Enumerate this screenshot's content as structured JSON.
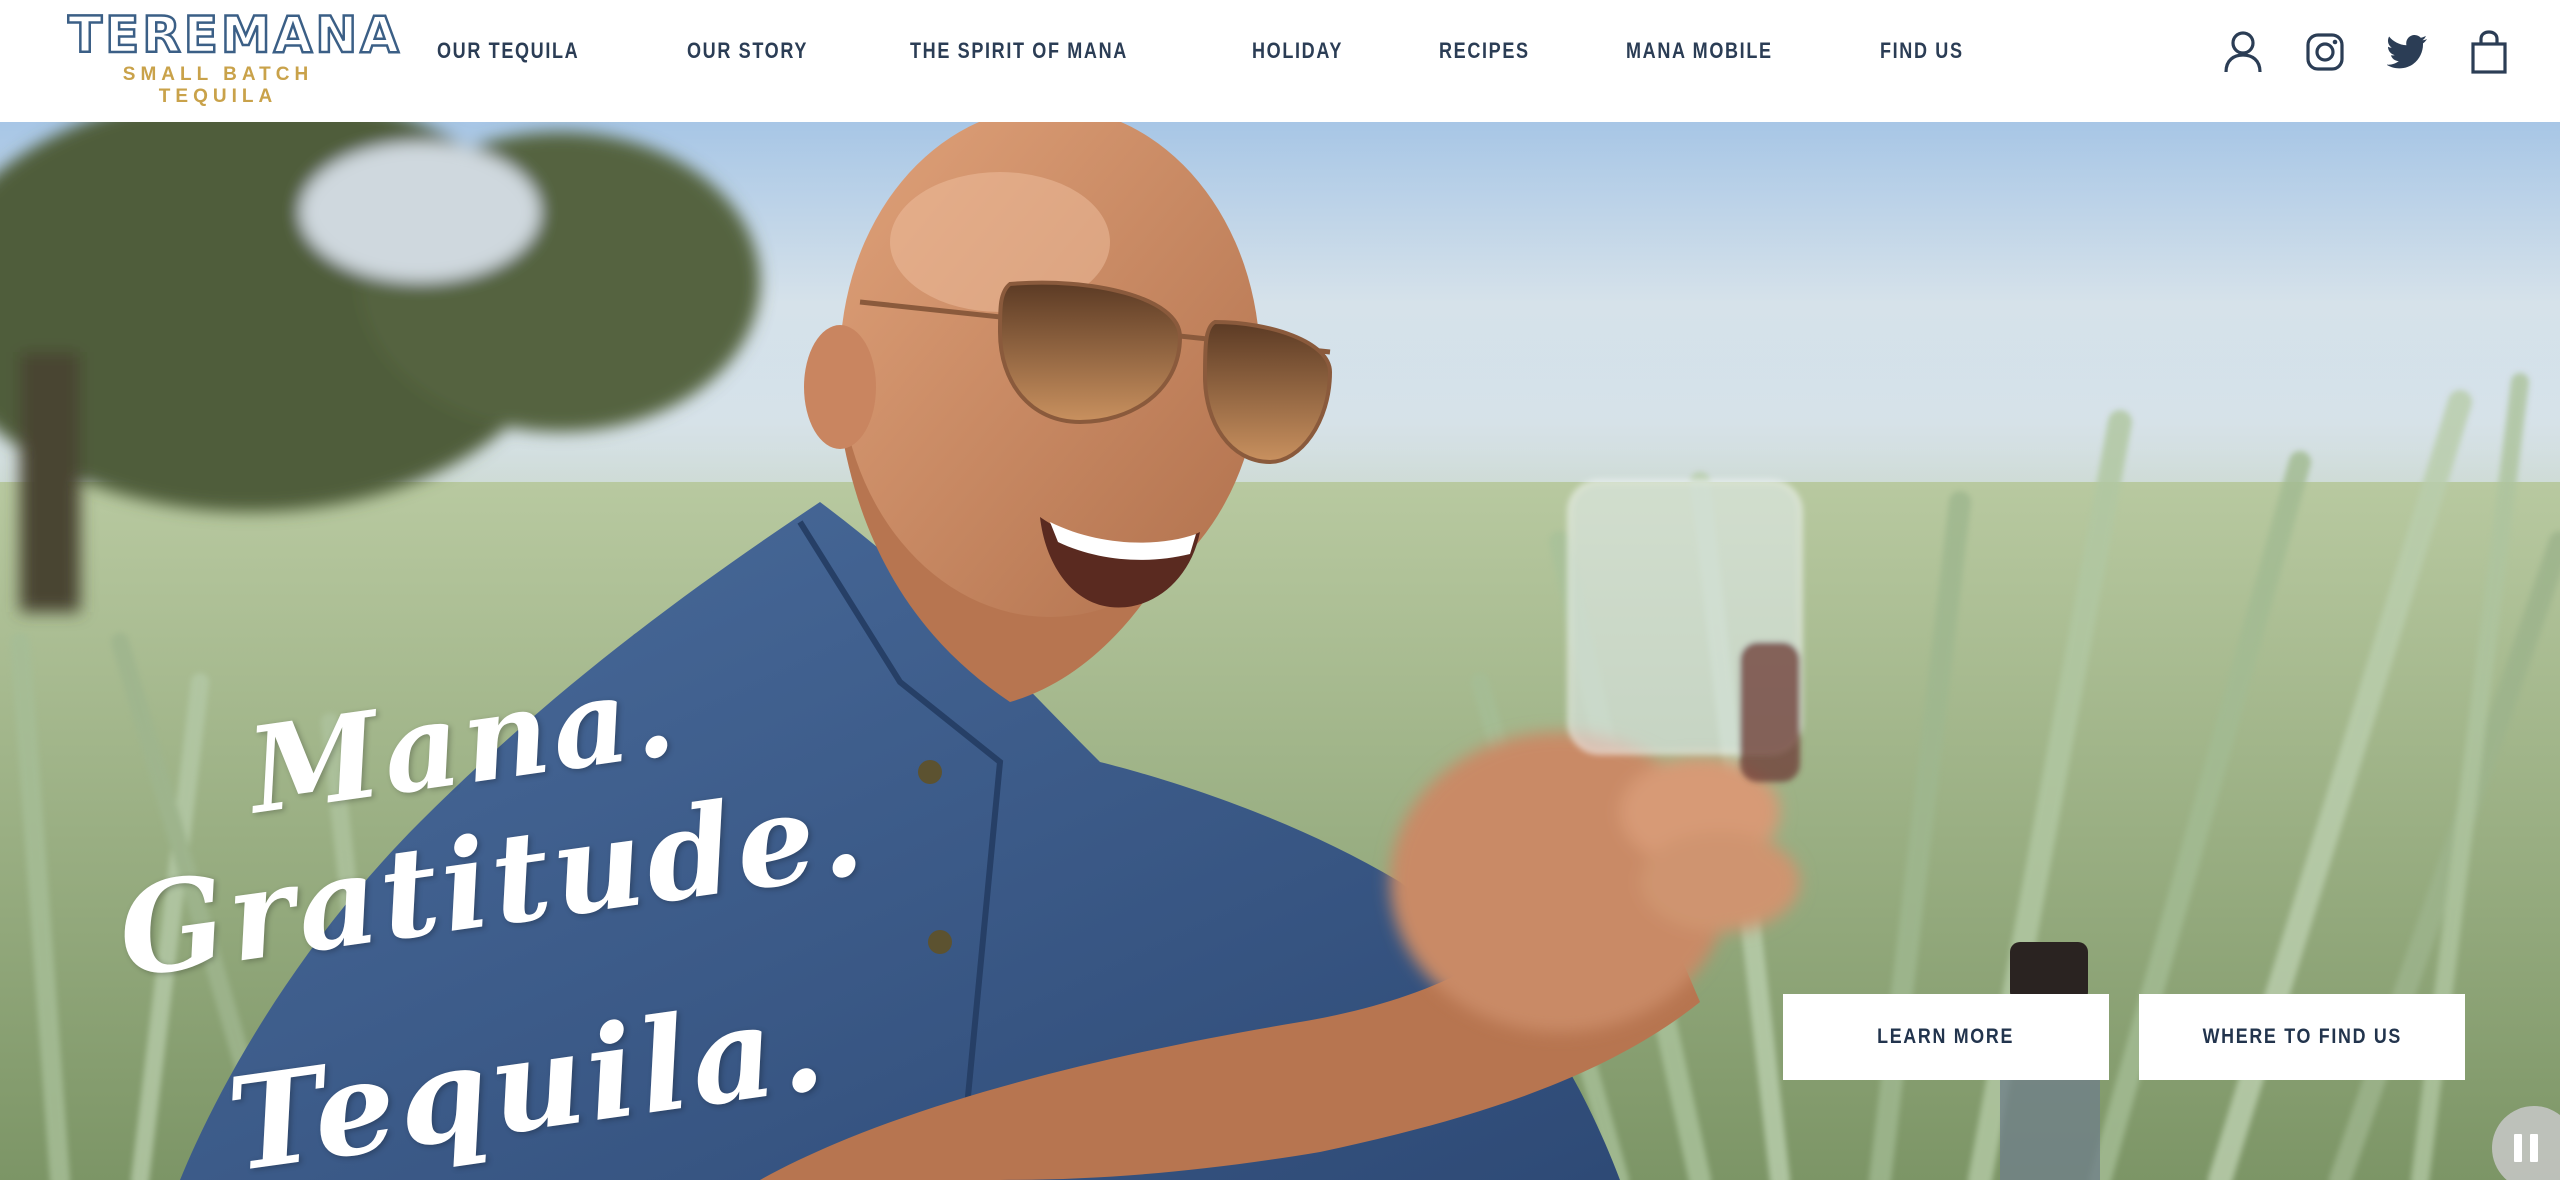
{
  "brand": {
    "name": "TEREMANA",
    "tagline": "SMALL BATCH TEQUILA",
    "color_primary": "#3b5f86",
    "color_gold": "#c9a24a"
  },
  "nav": {
    "items": [
      {
        "label": "OUR TEQUILA"
      },
      {
        "label": "OUR STORY"
      },
      {
        "label": "THE SPIRIT OF MANA"
      },
      {
        "label": "HOLIDAY"
      },
      {
        "label": "RECIPES"
      },
      {
        "label": "MANA MOBILE"
      },
      {
        "label": "FIND US"
      }
    ]
  },
  "header_icons": [
    "account-icon",
    "instagram-icon",
    "twitter-icon",
    "cart-icon"
  ],
  "hero": {
    "headline": {
      "line1": "Mana.",
      "line2": "Gratitude.",
      "line3": "Tequila."
    },
    "buttons": {
      "learn_more": "LEARN MORE",
      "where_to_find": "WHERE TO FIND US"
    },
    "video_control": "pause-icon"
  }
}
